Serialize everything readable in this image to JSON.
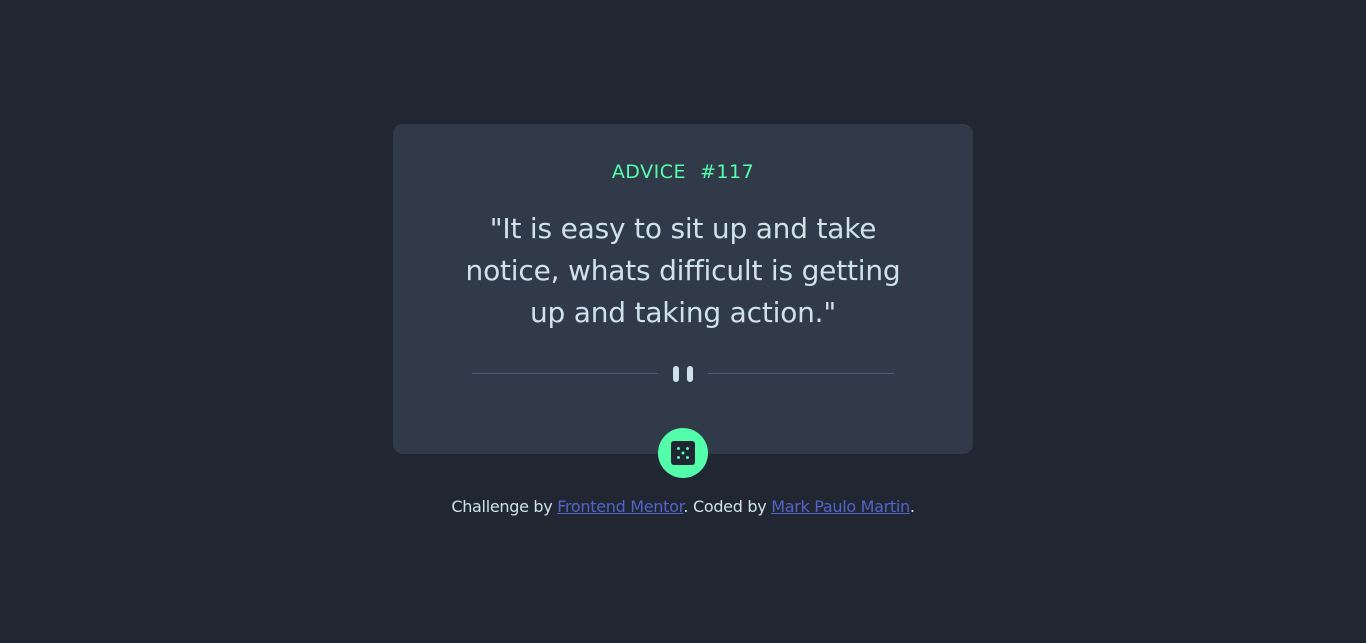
{
  "card": {
    "advice_label": "ADVICE",
    "advice_number": "#117",
    "quote": "\"It is easy to sit up and take notice, whats difficult is getting up and taking action.\"",
    "divider_icon": "pause-icon",
    "button_icon": "dice-icon"
  },
  "attribution": {
    "prefix": "Challenge by ",
    "link1": "Frontend Mentor",
    "middle": ". Coded by ",
    "link2": "Mark Paulo Martin",
    "suffix": "."
  },
  "colors": {
    "background": "#202632",
    "card": "#313A48",
    "accent_green": "#53FFAA",
    "text_light": "#CEE3E9",
    "divider": "#4F5D74",
    "link": "#5464C8"
  }
}
